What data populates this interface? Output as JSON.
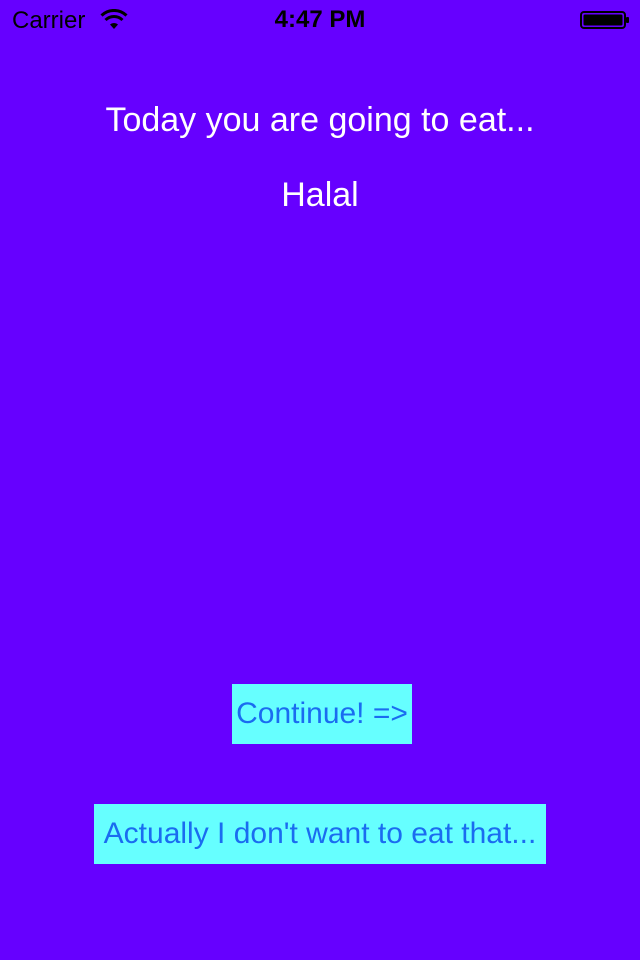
{
  "status_bar": {
    "carrier": "Carrier",
    "time": "4:47 PM",
    "icons": [
      "wifi-icon",
      "battery-icon"
    ]
  },
  "main": {
    "headline": "Today you are going to eat...",
    "food_choice": "Halal"
  },
  "buttons": {
    "continue_label": "Continue! =>",
    "reject_label": "Actually I don't want to eat that..."
  },
  "colors": {
    "background": "#6600ff",
    "button_background": "#66ffff",
    "button_text": "#1a6cf0",
    "text": "#ffffff"
  }
}
